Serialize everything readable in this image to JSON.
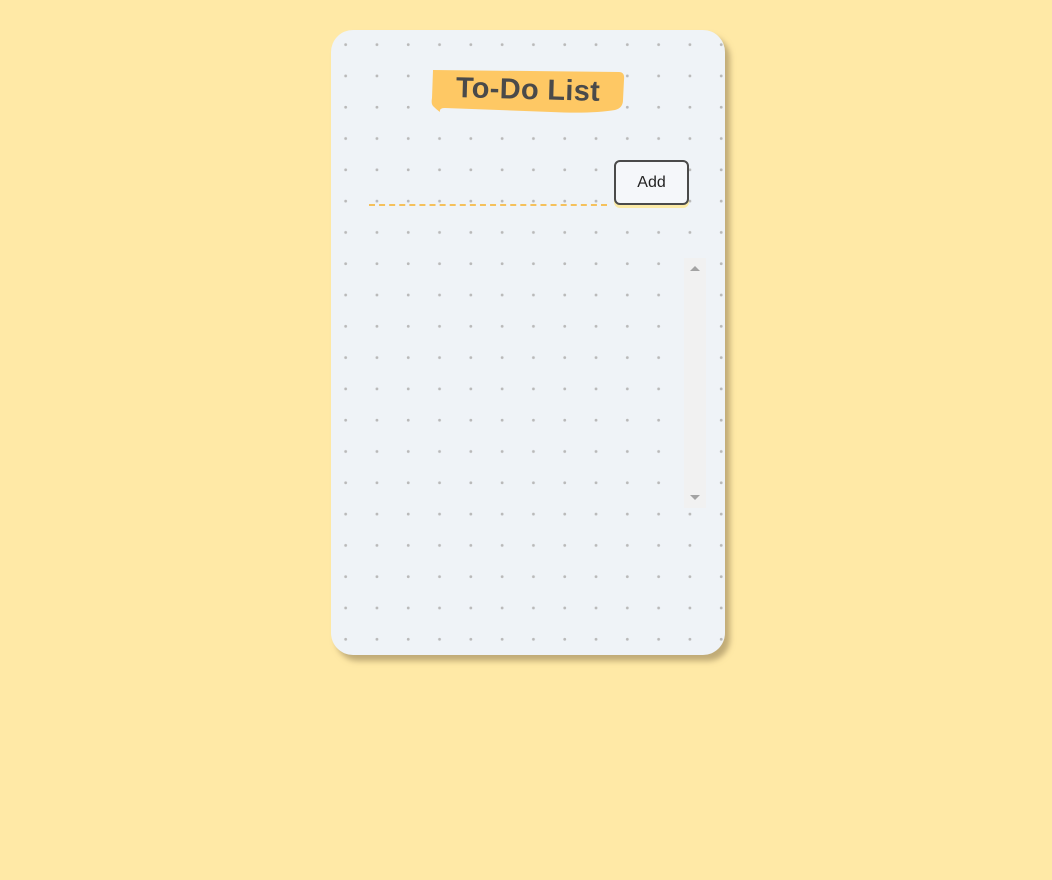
{
  "app": {
    "title": "To-Do List"
  },
  "form": {
    "task_input_value": "",
    "task_input_placeholder": "",
    "add_label": "Add"
  },
  "task_list": {
    "items": []
  },
  "colors": {
    "page_background": "#ffe9a6",
    "card_background": "#eff3f7",
    "dot_pattern": "#b9b9b9",
    "title_highlight": "#fec864",
    "title_text": "#4a4a4a",
    "input_underline": "#f5c15c",
    "button_border": "#4a4a4a"
  },
  "icons": {
    "scroll_up": "scroll-up-arrow-icon",
    "scroll_down": "scroll-down-arrow-icon"
  }
}
